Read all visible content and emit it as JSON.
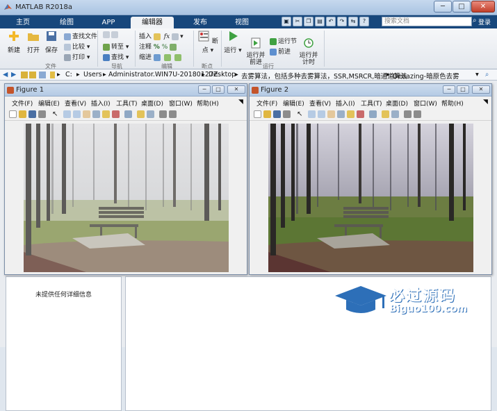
{
  "app": {
    "title": "MATLAB R2018a"
  },
  "window_buttons": {
    "min": "─",
    "max": "□",
    "close": "✕"
  },
  "tabs": [
    {
      "label": "主页"
    },
    {
      "label": "绘图"
    },
    {
      "label": "APP"
    },
    {
      "label": "编辑器"
    },
    {
      "label": "发布"
    },
    {
      "label": "视图"
    }
  ],
  "search": {
    "placeholder": "搜索文档"
  },
  "toolstrip_right": {
    "login": "登录"
  },
  "ribbon": {
    "new": "新建",
    "open": "打开",
    "save": "保存",
    "find_files": "查找文件",
    "compare": "比较",
    "print": "打印",
    "group_file": "文件",
    "goto": "转至",
    "find": "查找",
    "group_nav": "导航",
    "insert": "插入",
    "comment": "注释",
    "indent": "缩进",
    "group_edit": "编辑",
    "breakpoints": "断点",
    "group_breakpoints": "断点",
    "run": "运行",
    "run_advance": "运行并\n前进",
    "run_section": "运行节",
    "advance": "前进",
    "run_time": "运行并\n计时",
    "group_run": "运行"
  },
  "address": {
    "drive": "C:",
    "segments": [
      "Users",
      "Administrator.WIN7U-20180127Z",
      "Desktop",
      "去雾算法，包括多种去雾算法，SSR,MSRCR,暗通道算法",
      "Dehazing-暗原色去雾"
    ]
  },
  "figure1": {
    "title": "Figure 1"
  },
  "figure2": {
    "title": "Figure 2"
  },
  "figure_menu": [
    "文件(F)",
    "编辑(E)",
    "查看(V)",
    "插入(I)",
    "工具(T)",
    "桌面(D)",
    "窗口(W)",
    "帮助(H)"
  ],
  "details_panel": {
    "message": "未提供任何详细信息"
  },
  "watermark": {
    "title": "必过源码",
    "url": "Biguo100.com"
  },
  "colors": {
    "tab_bar": "#17477c",
    "accent": "#2d6fb8"
  }
}
